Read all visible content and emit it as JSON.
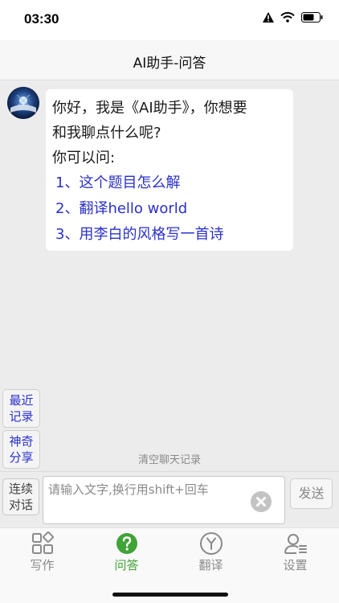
{
  "status_bar": {
    "time": "03:30",
    "icons": [
      "warning-icon",
      "wifi-icon",
      "battery-icon"
    ]
  },
  "nav": {
    "title": "AI助手-问答"
  },
  "chat": {
    "assistant_avatar": "assistant-avatar",
    "message_lines": [
      "你好，我是《AI助手》，你想要",
      "和我聊点什么呢?",
      "你可以问:"
    ],
    "suggestions": [
      "1、这个题目怎么解",
      "2、翻译hello world",
      "3、用李白的风格写一首诗"
    ]
  },
  "side_buttons": {
    "recent": [
      "最近",
      "记录"
    ],
    "share": [
      "神奇",
      "分享"
    ]
  },
  "clear_history": "清空聊天记录",
  "input_bar": {
    "continuous": [
      "连续",
      "对话"
    ],
    "placeholder": "请输入文字,换行用shift+回车",
    "send_label": "发送"
  },
  "tabs": [
    {
      "label": "写作",
      "icon": "grid-icon",
      "active": false
    },
    {
      "label": "问答",
      "icon": "question-icon",
      "active": true
    },
    {
      "label": "翻译",
      "icon": "translate-icon",
      "active": false
    },
    {
      "label": "设置",
      "icon": "user-settings-icon",
      "active": false
    }
  ],
  "colors": {
    "accent_green": "#3fa336",
    "link_blue": "#2a31c8",
    "background": "#ececec"
  }
}
